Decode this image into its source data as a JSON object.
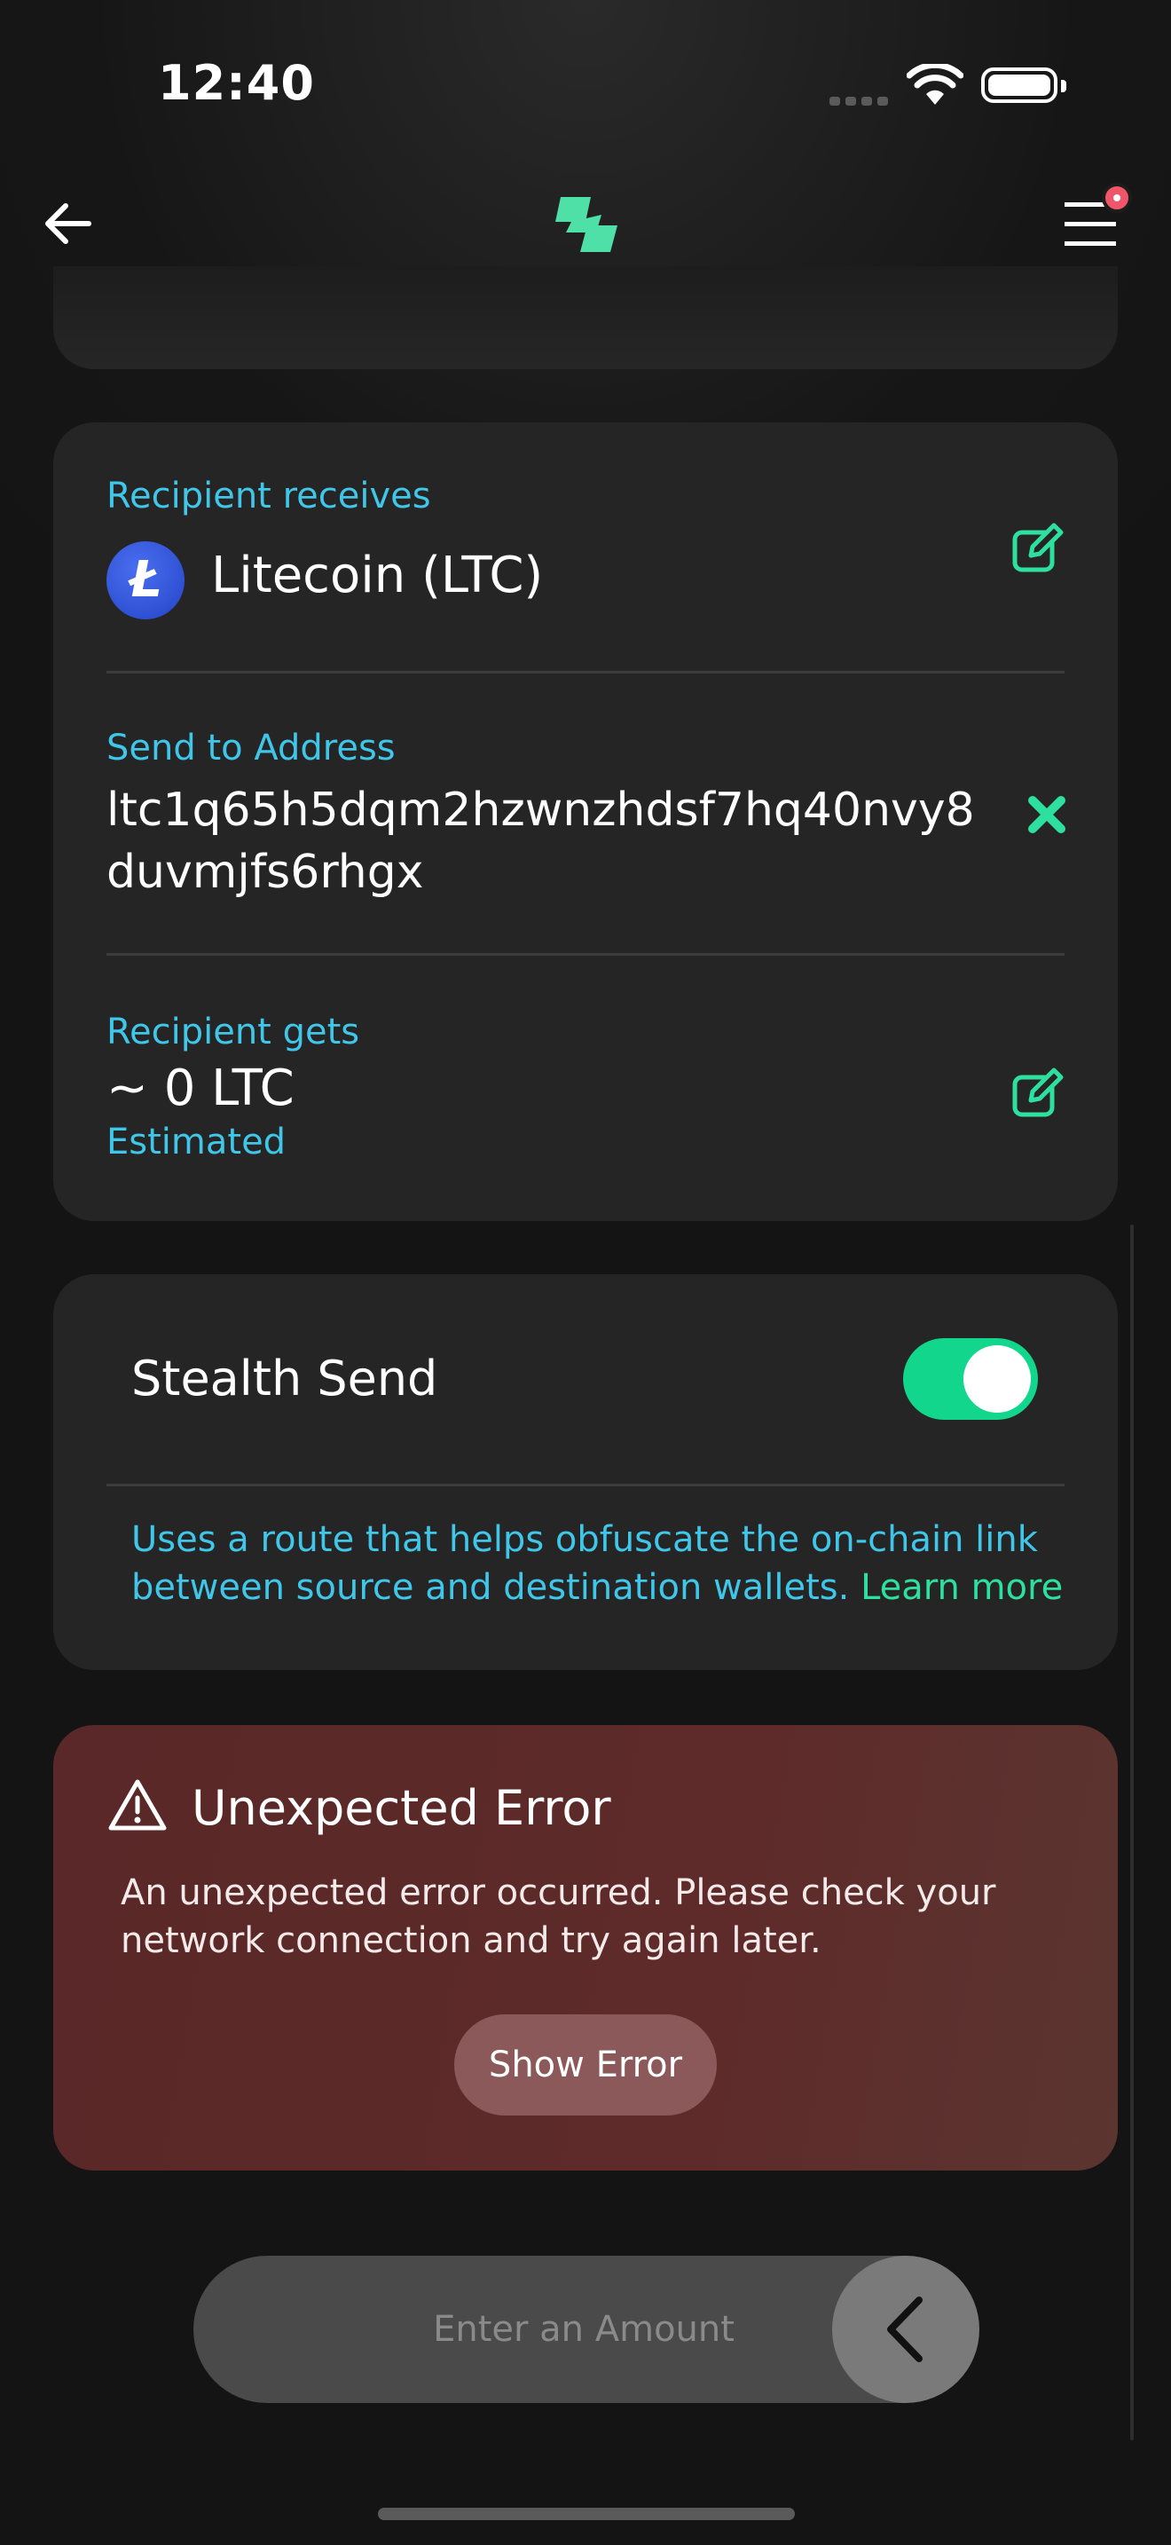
{
  "status_bar": {
    "time": "12:40"
  },
  "recipient": {
    "receives_label": "Recipient receives",
    "coin_symbol_letter": "Ł",
    "coin_name": "Litecoin (LTC)",
    "address_label": "Send to Address",
    "address_line1": "ltc1q65h5dqm2hzwnzhdsf7hq40nvy8",
    "address_line2": "duvmjfs6rhgx",
    "gets_label": "Recipient gets",
    "gets_value": "~ 0 LTC",
    "gets_note": "Estimated"
  },
  "stealth": {
    "title": "Stealth Send",
    "enabled": true,
    "description": "Uses a route that helps obfuscate the on-chain link between source and destination wallets.",
    "learn_more": "Learn more"
  },
  "error": {
    "title": "Unexpected Error",
    "message": "An unexpected error occurred. Please check your network connection and try again later.",
    "button": "Show Error"
  },
  "amount": {
    "placeholder": "Enter an Amount"
  },
  "colors": {
    "accent_teal": "#3fc6e8",
    "accent_green": "#11d68b",
    "error_bg": "#5e2a2a",
    "notification": "#f0566a"
  },
  "icons": {
    "back": "arrow-left-icon",
    "logo": "app-logo-icon",
    "menu": "hamburger-menu-icon",
    "edit": "edit-icon",
    "clear": "close-x-icon",
    "warning": "warning-triangle-icon",
    "submit": "chevron-left-icon"
  }
}
